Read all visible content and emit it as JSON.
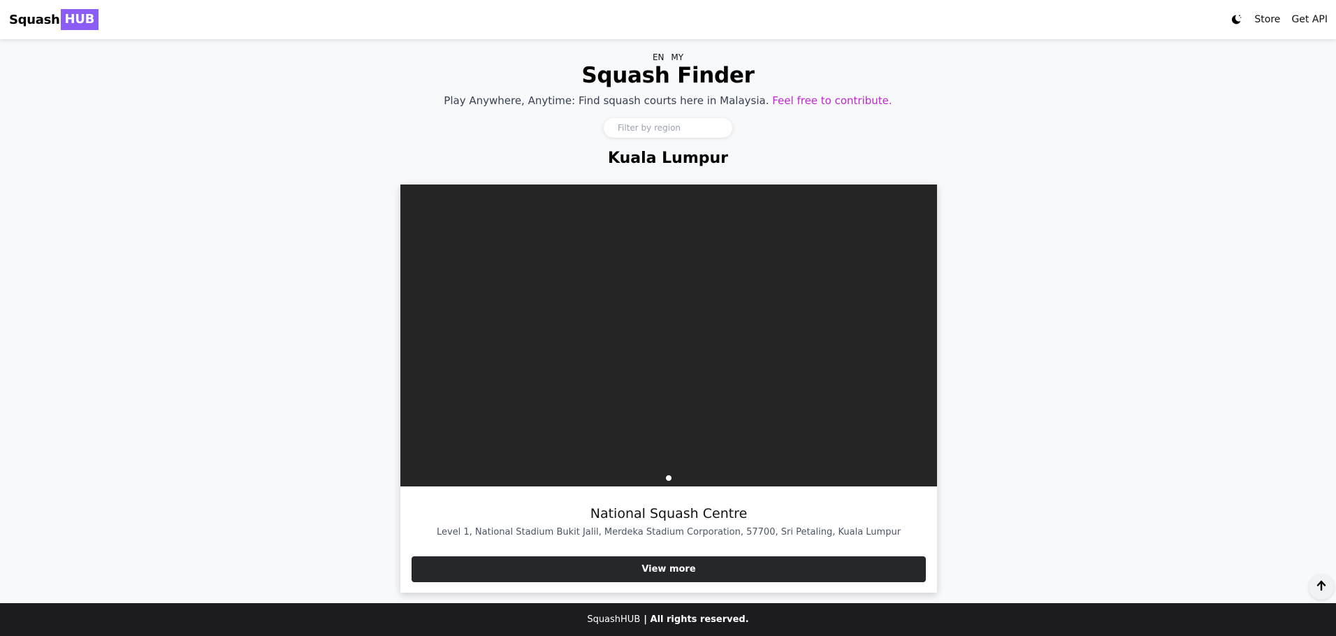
{
  "header": {
    "logo_part1": "Squash",
    "logo_part2": "HUB",
    "theme_icon": "moon-icon",
    "nav": {
      "store": "Store",
      "get_api": "Get API"
    }
  },
  "languages": [
    "EN",
    "MY"
  ],
  "hero": {
    "title": "Squash Finder",
    "subtitle": "Play Anywhere, Anytime: Find squash courts here in Malaysia.",
    "contribute_link": "Feel free to contribute."
  },
  "filter": {
    "placeholder": "Filter by region"
  },
  "region": {
    "name": "Kuala Lumpur"
  },
  "venue": {
    "name": "National Squash Centre",
    "address": "Level 1, National Stadium Bukit Jalil, Merdeka Stadium Corporation, 57700, Sri Petaling, Kuala Lumpur",
    "button": "View more"
  },
  "back_to_top_icon": "arrow-up-icon",
  "footer": {
    "brand": "SquashHUB",
    "rights": "| All rights reserved."
  },
  "colors": {
    "accent": "#8b5cf6",
    "link": "#c026d3",
    "footer_bg": "#1c1b1f",
    "button_bg": "#26272b"
  }
}
